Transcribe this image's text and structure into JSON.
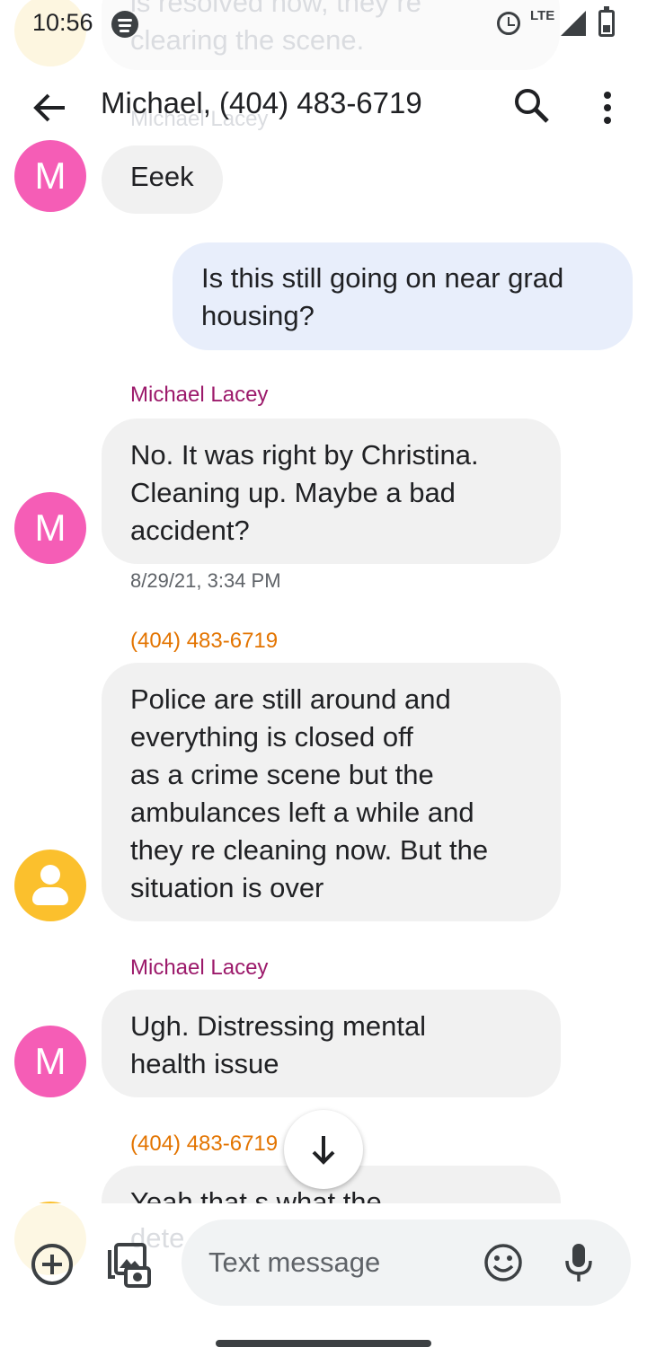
{
  "status_bar": {
    "time": "10:56",
    "network": "LTE"
  },
  "header": {
    "title": "Michael, (404) 483-6719"
  },
  "partial_top": {
    "text_line1": "is resolved now, they re",
    "text_line2": "clearing the scene.",
    "sender": "Michael Lacey"
  },
  "messages": [
    {
      "type": "incoming",
      "text": "Eeek"
    },
    {
      "type": "outgoing",
      "line1": "Is this still going on near grad",
      "line2": "housing?"
    },
    {
      "type": "incoming",
      "sender": "Michael Lacey",
      "avatar_letter": "M",
      "line1": "No. It was right by Christina.",
      "line2": "Cleaning up. Maybe a bad",
      "line3": "accident?",
      "timestamp": "8/29/21, 3:34 PM"
    },
    {
      "type": "incoming",
      "sender": "(404) 483-6719",
      "line1": "Police are still around and",
      "line2": "everything is closed off",
      "line3": "as a crime scene but the",
      "line4": "ambulances left a while and",
      "line5": "they re cleaning now. But the",
      "line6": "situation is over"
    },
    {
      "type": "incoming",
      "sender": "Michael Lacey",
      "avatar_letter": "M",
      "line1": "Ugh. Distressing mental",
      "line2": "health issue"
    },
    {
      "type": "incoming",
      "sender": "(404) 483-6719",
      "partial_line1": "Yeah that s what the",
      "partial_line2": "dete"
    }
  ],
  "first_avatar_letter": "M",
  "compose": {
    "placeholder": "Text message"
  },
  "icons": {
    "back": "arrow-back-icon",
    "search": "search-icon",
    "more": "more-vert-icon",
    "scroll_down": "arrow-down-icon",
    "add": "add-circle-icon",
    "gallery": "gallery-icon",
    "emoji": "emoji-icon",
    "mic": "mic-icon"
  },
  "colors": {
    "michael_avatar": "#f55db6",
    "number_avatar": "#fbc02d",
    "michael_name": "#9c1a6b",
    "number_name": "#e37400",
    "incoming_bubble": "#f1f1f1",
    "outgoing_bubble": "#e8eefb",
    "compose_field": "#f1f3f4"
  }
}
